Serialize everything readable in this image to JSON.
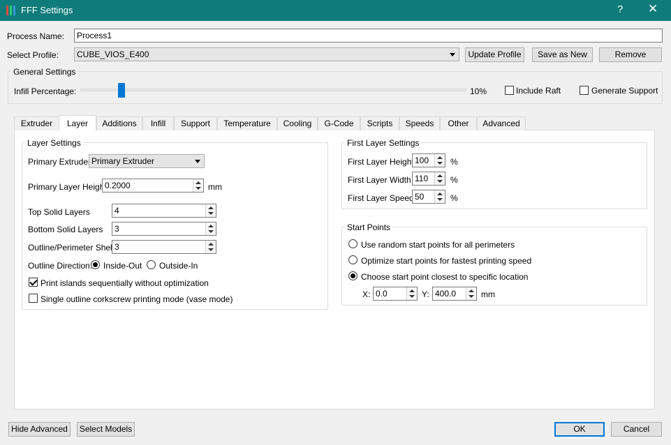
{
  "window": {
    "title": "FFF Settings",
    "help": "?",
    "close": "✕"
  },
  "process": {
    "label": "Process Name:",
    "value": "Process1"
  },
  "profile": {
    "label": "Select Profile:",
    "value": "CUBE_VIOS_E400",
    "update": "Update Profile",
    "save_new": "Save as New",
    "remove": "Remove"
  },
  "general": {
    "title": "General Settings",
    "infill_label": "Infill Percentage:",
    "infill_value": "10%",
    "infill_fraction": 0.1,
    "include_raft": "Include Raft",
    "generate_support": "Generate Support"
  },
  "tabs": [
    "Extruder",
    "Layer",
    "Additions",
    "Infill",
    "Support",
    "Temperature",
    "Cooling",
    "G-Code",
    "Scripts",
    "Speeds",
    "Other",
    "Advanced"
  ],
  "layer": {
    "title": "Layer Settings",
    "primary_extruder_label": "Primary Extruder",
    "primary_extruder_value": "Primary Extruder",
    "primary_height_label": "Primary Layer Height",
    "primary_height_value": "0.2000",
    "unit_mm": "mm",
    "top_solid_label": "Top Solid Layers",
    "top_solid_value": "4",
    "bottom_solid_label": "Bottom Solid Layers",
    "bottom_solid_value": "3",
    "outline_label": "Outline/Perimeter Shells",
    "outline_value": "3",
    "direction_label": "Outline Direction:",
    "inside_out": "Inside-Out",
    "outside_in": "Outside-In",
    "print_islands": "Print islands sequentially without optimization",
    "vase_mode": "Single outline corkscrew printing mode (vase mode)"
  },
  "first_layer": {
    "title": "First Layer Settings",
    "height_label": "First Layer Height",
    "height_value": "100",
    "width_label": "First Layer Width",
    "width_value": "110",
    "speed_label": "First Layer Speed",
    "speed_value": "50",
    "unit_pct": "%"
  },
  "start_points": {
    "title": "Start Points",
    "random": "Use random start points for all perimeters",
    "optimize": "Optimize start points for fastest printing speed",
    "closest": "Choose start point closest to specific location",
    "x_label": "X:",
    "x_value": "0.0",
    "y_label": "Y:",
    "y_value": "400.0",
    "unit": "mm"
  },
  "footer": {
    "hide_advanced": "Hide Advanced",
    "select_models": "Select Models",
    "ok": "OK",
    "cancel": "Cancel"
  }
}
